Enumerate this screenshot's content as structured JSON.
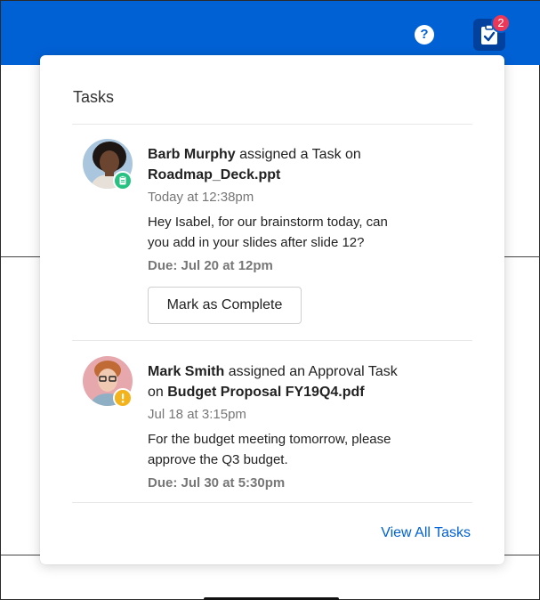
{
  "header": {
    "help_icon_glyph": "?",
    "tasks_badge_count": "2",
    "brand_color": "#0061d5"
  },
  "panel": {
    "title": "Tasks",
    "view_all_label": "View All Tasks"
  },
  "tasks": [
    {
      "author": "Barb Murphy",
      "action": " assigned a Task on",
      "target": "Roadmap_Deck.ppt",
      "time": "Today at 12:38pm",
      "message_line1": "Hey Isabel, for our brainstorm today, can",
      "message_line2": "you add in your slides after slide 12?",
      "due": "Due: Jul 20 at 12pm",
      "button_label": "Mark as Complete",
      "status_icon": "clipboard-icon",
      "status_color": "#26c281"
    },
    {
      "author": "Mark Smith",
      "action": " assigned an Approval Task",
      "target_prefix": "on ",
      "target": "Budget Proposal FY19Q4.pdf",
      "time": "Jul 18 at 3:15pm",
      "message_line1": "For the budget meeting tomorrow, please",
      "message_line2": "approve the Q3 budget.",
      "due": "Due: Jul 30 at 5:30pm",
      "status_icon": "alert-icon",
      "status_color": "#f5b31b"
    }
  ]
}
